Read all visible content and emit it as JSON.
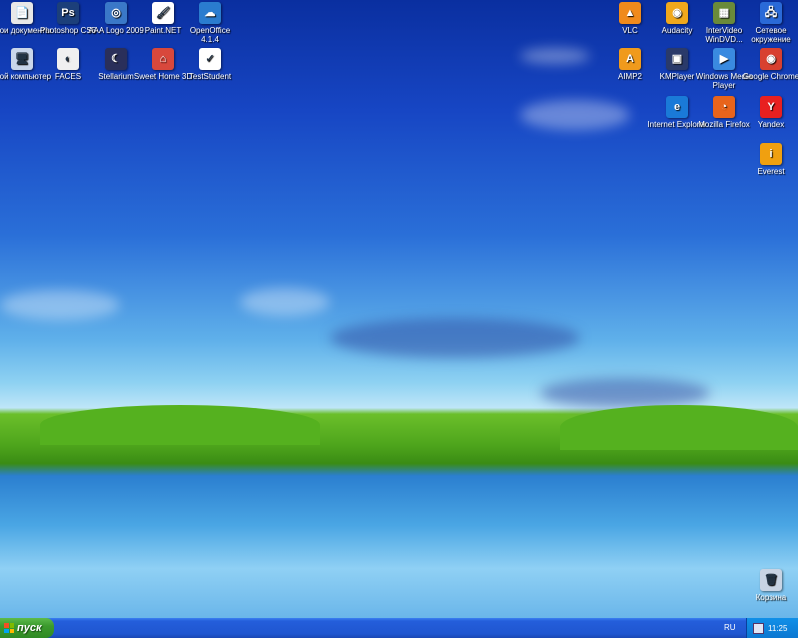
{
  "desktop_icons_left": [
    {
      "label": "Мои документы",
      "icon": "my-documents-icon",
      "color": "#e8e8e8",
      "glyph": "📄"
    },
    {
      "label": "Photoshop CS5",
      "icon": "photoshop-icon",
      "color": "#1c3f7a",
      "glyph": "Ps"
    },
    {
      "label": "AAA Logo 2009",
      "icon": "aaa-logo-icon",
      "color": "#3a78c8",
      "glyph": "◎"
    },
    {
      "label": "Paint.NET",
      "icon": "paintnet-icon",
      "color": "#ffffff",
      "glyph": "🖌"
    },
    {
      "label": "OpenOffice 4.1.4",
      "icon": "openoffice-icon",
      "color": "#2a7ccf",
      "glyph": "☁"
    },
    {
      "label": "Мой компьютер",
      "icon": "my-computer-icon",
      "color": "#c9d6ea",
      "glyph": "🖥"
    },
    {
      "label": "FACES",
      "icon": "faces-icon",
      "color": "#f0f0f0",
      "glyph": "◐"
    },
    {
      "label": "Stellarium",
      "icon": "stellarium-icon",
      "color": "#2a2f5a",
      "glyph": "☾"
    },
    {
      "label": "Sweet Home 3D",
      "icon": "sweethome-icon",
      "color": "#d8483c",
      "glyph": "⌂"
    },
    {
      "label": "TestStudent",
      "icon": "teststudent-icon",
      "color": "#ffffff",
      "glyph": "✓"
    }
  ],
  "desktop_icons_right": [
    {
      "label": "VLC",
      "icon": "vlc-icon",
      "color": "#f08a1c",
      "glyph": "▲"
    },
    {
      "label": "Audacity",
      "icon": "audacity-icon",
      "color": "#f0a81c",
      "glyph": "◉"
    },
    {
      "label": "InterVideo WinDVD...",
      "icon": "windvd-icon",
      "color": "#6a8a3a",
      "glyph": "▦"
    },
    {
      "label": "Сетевое окружение",
      "icon": "network-icon",
      "color": "#2a6ad8",
      "glyph": "🖧"
    },
    {
      "label": "AIMP2",
      "icon": "aimp-icon",
      "color": "#f09a1c",
      "glyph": "A"
    },
    {
      "label": "KMPlayer",
      "icon": "kmplayer-icon",
      "color": "#2a3a6a",
      "glyph": "▣"
    },
    {
      "label": "Windows Media Player",
      "icon": "wmp-icon",
      "color": "#3a8ae0",
      "glyph": "▶"
    },
    {
      "label": "Google Chrome",
      "icon": "chrome-icon",
      "color": "#d84030",
      "glyph": "◉"
    },
    {
      "label": "Internet Explorer",
      "icon": "ie-icon",
      "color": "#1a7ad8",
      "glyph": "e"
    },
    {
      "label": "Mozilla Firefox",
      "icon": "firefox-icon",
      "color": "#e8641c",
      "glyph": "◔"
    },
    {
      "label": "Yandex",
      "icon": "yandex-icon",
      "color": "#e82020",
      "glyph": "Y"
    },
    {
      "label": "Everest",
      "icon": "everest-icon",
      "color": "#f0a010",
      "glyph": "i"
    },
    {
      "label": "Корзина",
      "icon": "recycle-bin-icon",
      "color": "#c8d4e4",
      "glyph": "🗑"
    }
  ],
  "taskbar": {
    "start_label": "пуск",
    "language": "RU",
    "clock": "11:25"
  }
}
